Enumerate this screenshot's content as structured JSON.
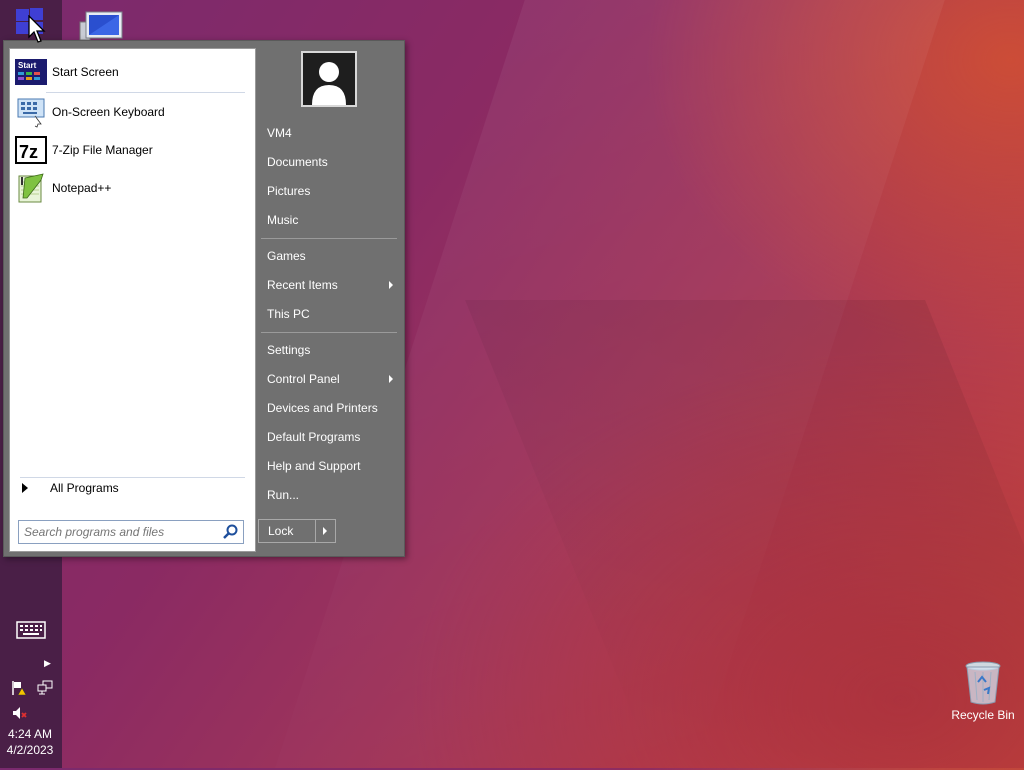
{
  "start_menu": {
    "programs": [
      {
        "label": "Start Screen",
        "icon": "start-screen-icon"
      },
      {
        "label": "On-Screen Keyboard",
        "icon": "keyboard-icon"
      },
      {
        "label": "7-Zip File Manager",
        "icon": "7zip-icon"
      },
      {
        "label": "Notepad++",
        "icon": "notepadpp-icon"
      }
    ],
    "start_icon_text": "Start",
    "zip_icon_text": "7z",
    "all_programs_label": "All Programs",
    "search_placeholder": "Search programs and files",
    "right_items": [
      {
        "label": "VM4"
      },
      {
        "label": "Documents"
      },
      {
        "label": "Pictures"
      },
      {
        "label": "Music"
      },
      {
        "label": "Games"
      },
      {
        "label": "Recent Items",
        "submenu": true
      },
      {
        "label": "This PC"
      },
      {
        "label": "Settings"
      },
      {
        "label": "Control Panel",
        "submenu": true
      },
      {
        "label": "Devices and Printers"
      },
      {
        "label": "Default Programs"
      },
      {
        "label": "Help and Support"
      },
      {
        "label": "Run..."
      }
    ],
    "lock_label": "Lock"
  },
  "taskbar": {
    "time": "4:24 AM",
    "date": "4/2/2023"
  },
  "desktop": {
    "recycle_bin_label": "Recycle Bin"
  },
  "colors": {
    "taskbar": "#4a1f47",
    "menu_right": "#707070",
    "start_tile": "#3f3fd4"
  }
}
